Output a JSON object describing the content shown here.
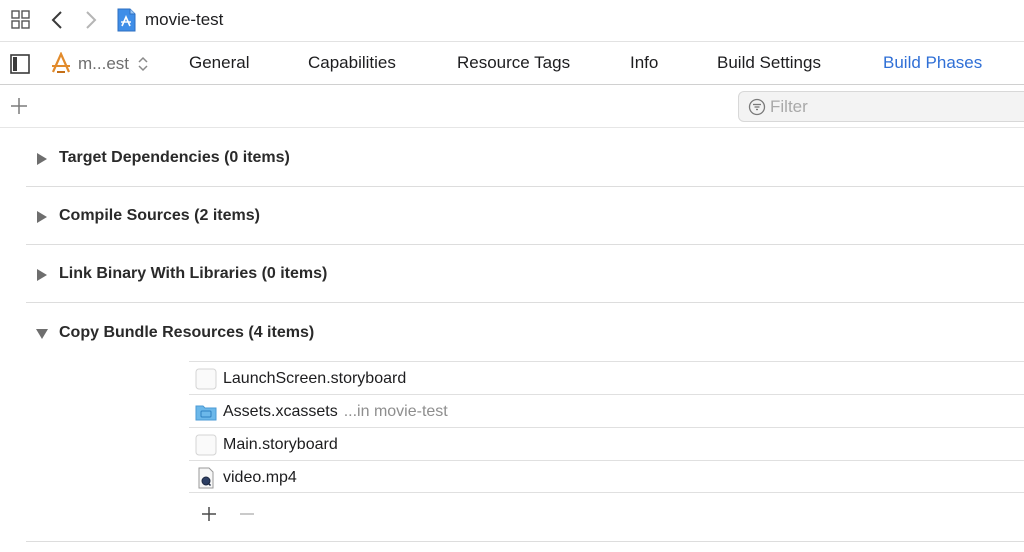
{
  "navbar": {
    "title": "movie-test"
  },
  "tabbar": {
    "target_label": "m...est",
    "tabs": [
      {
        "label": "General",
        "active": false
      },
      {
        "label": "Capabilities",
        "active": false
      },
      {
        "label": "Resource Tags",
        "active": false
      },
      {
        "label": "Info",
        "active": false
      },
      {
        "label": "Build Settings",
        "active": false
      },
      {
        "label": "Build Phases",
        "active": true
      }
    ]
  },
  "toolbar": {
    "filter_placeholder": "Filter",
    "filter_value": ""
  },
  "phases": [
    {
      "title": "Target Dependencies (0 items)",
      "expanded": false
    },
    {
      "title": "Compile Sources (2 items)",
      "expanded": false
    },
    {
      "title": "Link Binary With Libraries (0 items)",
      "expanded": false
    },
    {
      "title": "Copy Bundle Resources (4 items)",
      "expanded": true
    }
  ],
  "resources": [
    {
      "name": "LaunchScreen.storyboard",
      "location": "",
      "icon": "storyboard-icon"
    },
    {
      "name": "Assets.xcassets",
      "location": "...in movie-test",
      "icon": "asset-folder-icon"
    },
    {
      "name": "Main.storyboard",
      "location": "",
      "icon": "storyboard-icon"
    },
    {
      "name": "video.mp4",
      "location": "",
      "icon": "video-file-icon"
    }
  ],
  "colors": {
    "accent": "#2f6fd6",
    "folder_blue": "#6cb8ea"
  }
}
